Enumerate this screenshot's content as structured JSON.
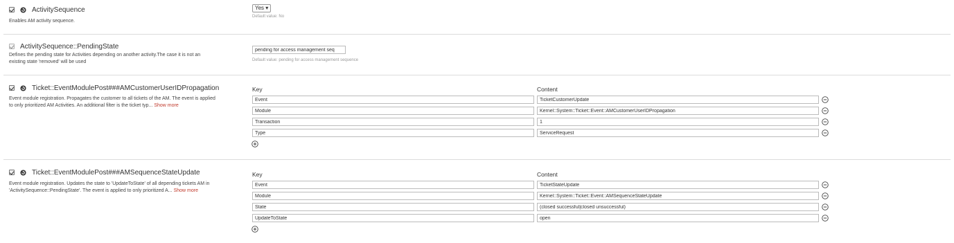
{
  "settings": [
    {
      "title": "ActivitySequence",
      "description": "Enables AM activity sequence.",
      "select_value": "Yes ▾",
      "default_value": "Default value: No"
    },
    {
      "title": "ActivitySequence::PendingState",
      "description_line1": "Defines the pending state for Activities depending on another activity.The case it is not an",
      "description_line2": "existing state 'removed' will be used",
      "input_value": "pending for access management seq",
      "default_value": "Default value: pending for access management sequence"
    },
    {
      "title": "Ticket::EventModulePost###AMCustomerUserIDPropagation",
      "description_line1": "Event module registration. Propagates the customer to all tickets of the AM. The event is applied",
      "description_line2": "to only prioritized AM Activities. An additional filter is the ticket typ...",
      "show_more": "Show more",
      "key_header": "Key",
      "content_header": "Content",
      "rows": [
        {
          "key": "Event",
          "content": "TicketCustomerUpdate"
        },
        {
          "key": "Module",
          "content": "Kernel::System::Ticket::Event::AMCustomerUserIDPropagation"
        },
        {
          "key": "Transaction",
          "content": "1"
        },
        {
          "key": "Type",
          "content": "ServiceRequest"
        }
      ]
    },
    {
      "title": "Ticket::EventModulePost###AMSequenceStateUpdate",
      "description_line1": "Event module registration. Updates the state to 'UpdateToState' of all depending tickets AM in",
      "description_line2": "'ActivitySequence::PendingState'. The event is applied to only prioritized A...",
      "show_more": "Show more",
      "key_header": "Key",
      "content_header": "Content",
      "rows": [
        {
          "key": "Event",
          "content": "TicketStateUpdate"
        },
        {
          "key": "Module",
          "content": "Kernel::System::Ticket::Event::AMSequenceStateUpdate"
        },
        {
          "key": "State",
          "content": "(closed successful|closed unsuccessful)"
        },
        {
          "key": "UpdateToState",
          "content": "open"
        }
      ]
    }
  ],
  "icons": {
    "checkbox": "checkbox-checked-icon",
    "reset": "reset-circular-arrow-icon",
    "remove": "minus-circle-icon",
    "add": "plus-circle-icon"
  }
}
